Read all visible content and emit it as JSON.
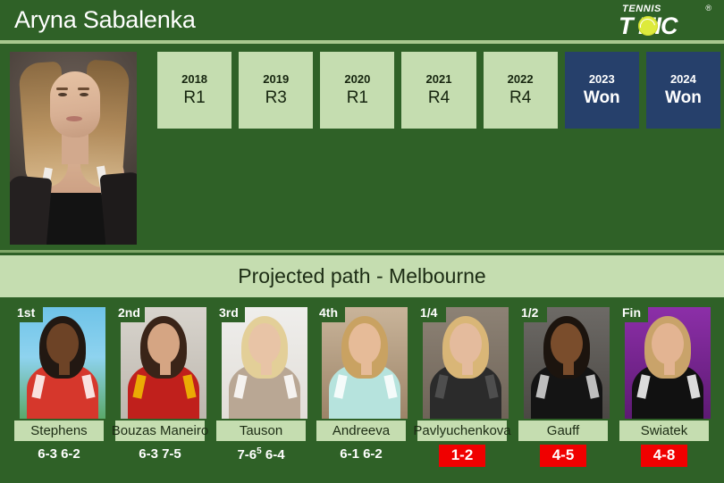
{
  "header": {
    "player_name": "Aryna Sabalenka",
    "logo_top": "TENNIS",
    "logo_word": "T NIC",
    "logo_registered": "®",
    "logo_ball_icon": "tennis-ball-icon"
  },
  "history": {
    "years": [
      {
        "year": "2018",
        "result": "R1",
        "won": false
      },
      {
        "year": "2019",
        "result": "R3",
        "won": false
      },
      {
        "year": "2020",
        "result": "R1",
        "won": false
      },
      {
        "year": "2021",
        "result": "R4",
        "won": false
      },
      {
        "year": "2022",
        "result": "R4",
        "won": false
      },
      {
        "year": "2023",
        "result": "Won",
        "won": true
      },
      {
        "year": "2024",
        "result": "Won",
        "won": true
      }
    ]
  },
  "section": {
    "title": "Projected path - Melbourne"
  },
  "path": {
    "cards": [
      {
        "round": "1st",
        "name": "Stephens",
        "score": "6-3 6-2",
        "score_sup": "",
        "score_tail": "",
        "odds": ""
      },
      {
        "round": "2nd",
        "name": "Bouzas Maneiro",
        "score": "6-3 7-5",
        "score_sup": "",
        "score_tail": "",
        "odds": ""
      },
      {
        "round": "3rd",
        "name": "Tauson",
        "score": "7-6",
        "score_sup": "5",
        "score_tail": "6-4",
        "odds": ""
      },
      {
        "round": "4th",
        "name": "Andreeva",
        "score": "6-1 6-2",
        "score_sup": "",
        "score_tail": "",
        "odds": ""
      },
      {
        "round": "1/4",
        "name": "Pavlyuchenkova",
        "score": "",
        "score_sup": "",
        "score_tail": "",
        "odds": "1-2"
      },
      {
        "round": "1/2",
        "name": "Gauff",
        "score": "",
        "score_sup": "",
        "score_tail": "",
        "odds": "4-5"
      },
      {
        "round": "Fin",
        "name": "Swiatek",
        "score": "",
        "score_sup": "",
        "score_tail": "",
        "odds": "4-8"
      }
    ]
  },
  "colors": {
    "background_green": "#2f6127",
    "light_green": "#c5ddb0",
    "navy": "#26406b",
    "red_badge": "#f00000",
    "white": "#ffffff",
    "rule_green": "#a9c98e"
  }
}
